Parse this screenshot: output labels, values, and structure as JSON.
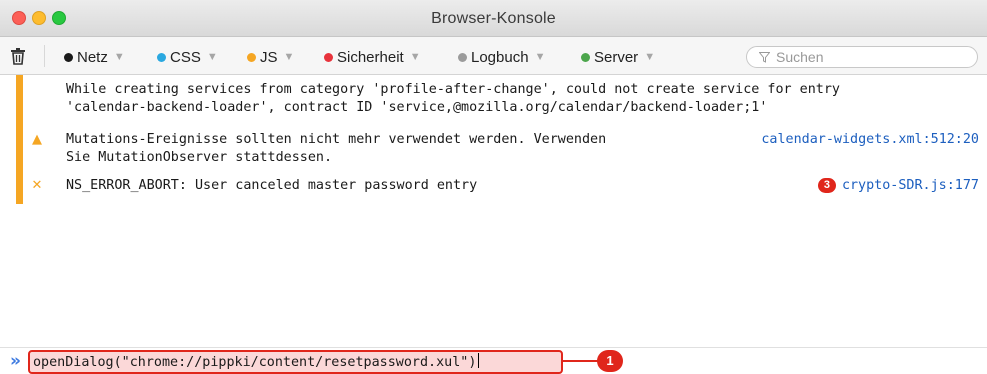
{
  "window": {
    "title": "Browser-Konsole"
  },
  "toolbar": {
    "filters": [
      {
        "label": "Netz",
        "color": "#1a1a1a"
      },
      {
        "label": "CSS",
        "color": "#2aa8e0"
      },
      {
        "label": "JS",
        "color": "#f5a623"
      },
      {
        "label": "Sicherheit",
        "color": "#e8333c"
      },
      {
        "label": "Logbuch",
        "color": "#9b9b9b"
      },
      {
        "label": "Server",
        "color": "#4ca64c"
      }
    ],
    "search_placeholder": "Suchen"
  },
  "messages": [
    {
      "icon": "",
      "text": "While creating services from category 'profile-after-change', could not create service for entry\n'calendar-backend-loader', contract ID 'service,@mozilla.org/calendar/backend-loader;1'",
      "link": ""
    },
    {
      "icon": "warning-icon",
      "text": "Mutations-Ereignisse sollten nicht mehr verwendet werden. Verwenden\nSie MutationObserver stattdessen.",
      "link": "calendar-widgets.xml:512:20"
    },
    {
      "icon": "error-icon",
      "text": "NS_ERROR_ABORT: User canceled master password entry",
      "count": "3",
      "link": "crypto-SDR.js:177"
    }
  ],
  "input": {
    "command": "openDialog(\"chrome://pippki/content/resetpassword.xul\")",
    "callout_number": "1"
  }
}
